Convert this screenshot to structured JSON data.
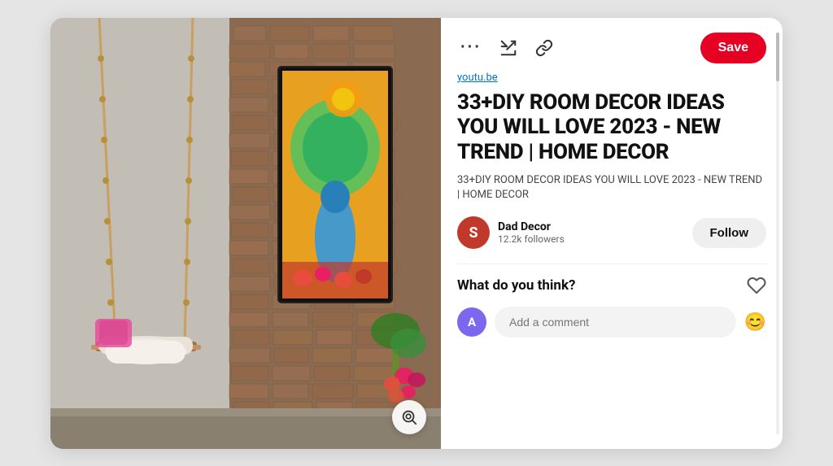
{
  "card": {
    "image_alt": "Indian style room with hanging swing, decorative pillow, and Krishna painting on brick wall"
  },
  "toolbar": {
    "more_label": "···",
    "share_label": "⬆",
    "link_label": "🔗",
    "save_label": "Save"
  },
  "pin": {
    "source_url": "youtu.be",
    "title": "33+DIY ROOM DECOR IDEAS YOU WILL LOVE 2023 - NEW TREND | HOME DECOR",
    "description": "33+DIY ROOM DECOR IDEAS YOU WILL LOVE 2023 - NEW TREND | HOME DECOR"
  },
  "author": {
    "initial": "S",
    "name": "Dad Decor",
    "followers": "12.2k followers",
    "follow_label": "Follow"
  },
  "interaction": {
    "what_do_you_think": "What do you think?",
    "comment_placeholder": "Add a comment",
    "commenter_initial": "A",
    "emoji": "😊"
  },
  "colors": {
    "save_btn": "#e60023",
    "avatar_bg": "#c0392b",
    "commenter_bg": "#7b68ee"
  }
}
